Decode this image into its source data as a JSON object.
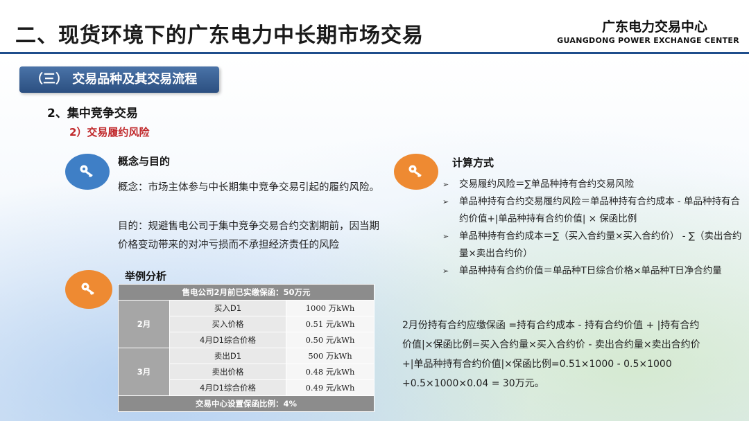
{
  "header": {
    "title": "二、现货环境下的广东电力中长期市场交易",
    "org_cn": "广东电力交易中心",
    "org_en": "GUANGDONG POWER EXCHANGE CENTER"
  },
  "section": {
    "label": "（三） 交易品种及其交易流程",
    "sub1": "2、集中竞争交易",
    "sub2": "2）交易履约风险"
  },
  "concept": {
    "title": "概念与目的",
    "line1": "概念：市场主体参与中长期集中竞争交易引起的履约风险。",
    "line2": "目的：规避售电公司于集中竞争交易合约交割期前，因当期价格变动带来的对冲亏损而不承担经济责任的风险"
  },
  "example": {
    "title": "举例分析",
    "table_header": "售电公司2月前已实缴保函：50万元",
    "groups": [
      {
        "month": "2月",
        "rows": [
          {
            "item": "买入D1",
            "value": "1000 万kWh"
          },
          {
            "item": "买入价格",
            "value": "0.51 元/kWh"
          },
          {
            "item": "4月D1综合价格",
            "value": "0.50 元/kWh"
          }
        ]
      },
      {
        "month": "3月",
        "rows": [
          {
            "item": "卖出D1",
            "value": "500 万kWh"
          },
          {
            "item": "卖出价格",
            "value": "0.48 元/kWh"
          },
          {
            "item": "4月D1综合价格",
            "value": "0.49 元/kWh"
          }
        ]
      }
    ],
    "table_footer": "交易中心设置保函比例：4%"
  },
  "calculation": {
    "title": "计算方式",
    "items": [
      "交易履约风险＝∑单品种持有合约交易风险",
      "单品种持有合约交易履约风险＝单品种持有合约成本 - 单品种持有合约价值+|单品种持有合约价值| × 保函比例",
      "单品种持有合约成本＝∑（买入合约量×买入合约价） - ∑（卖出合约量×卖出合约价）",
      "单品种持有合约价值＝单品种T日综合价格×单品种T日净合约量"
    ],
    "formula": "2月份持有合约应缴保函 =持有合约成本 - 持有合约价值 + |持有合约价值|×保函比例=买入合约量×买入合约价 - 卖出合约量×卖出合约价+|单品种持有合约价值|×保函比例=0.51×1000 - 0.5×1000 +0.5×1000×0.04 = 30万元。"
  },
  "colors": {
    "accent_blue": "#3f7fc6",
    "accent_orange": "#ee8a32",
    "section_pill": "#2b4f80",
    "highlight_red": "#c0282b"
  },
  "icons": [
    "key-icon"
  ]
}
